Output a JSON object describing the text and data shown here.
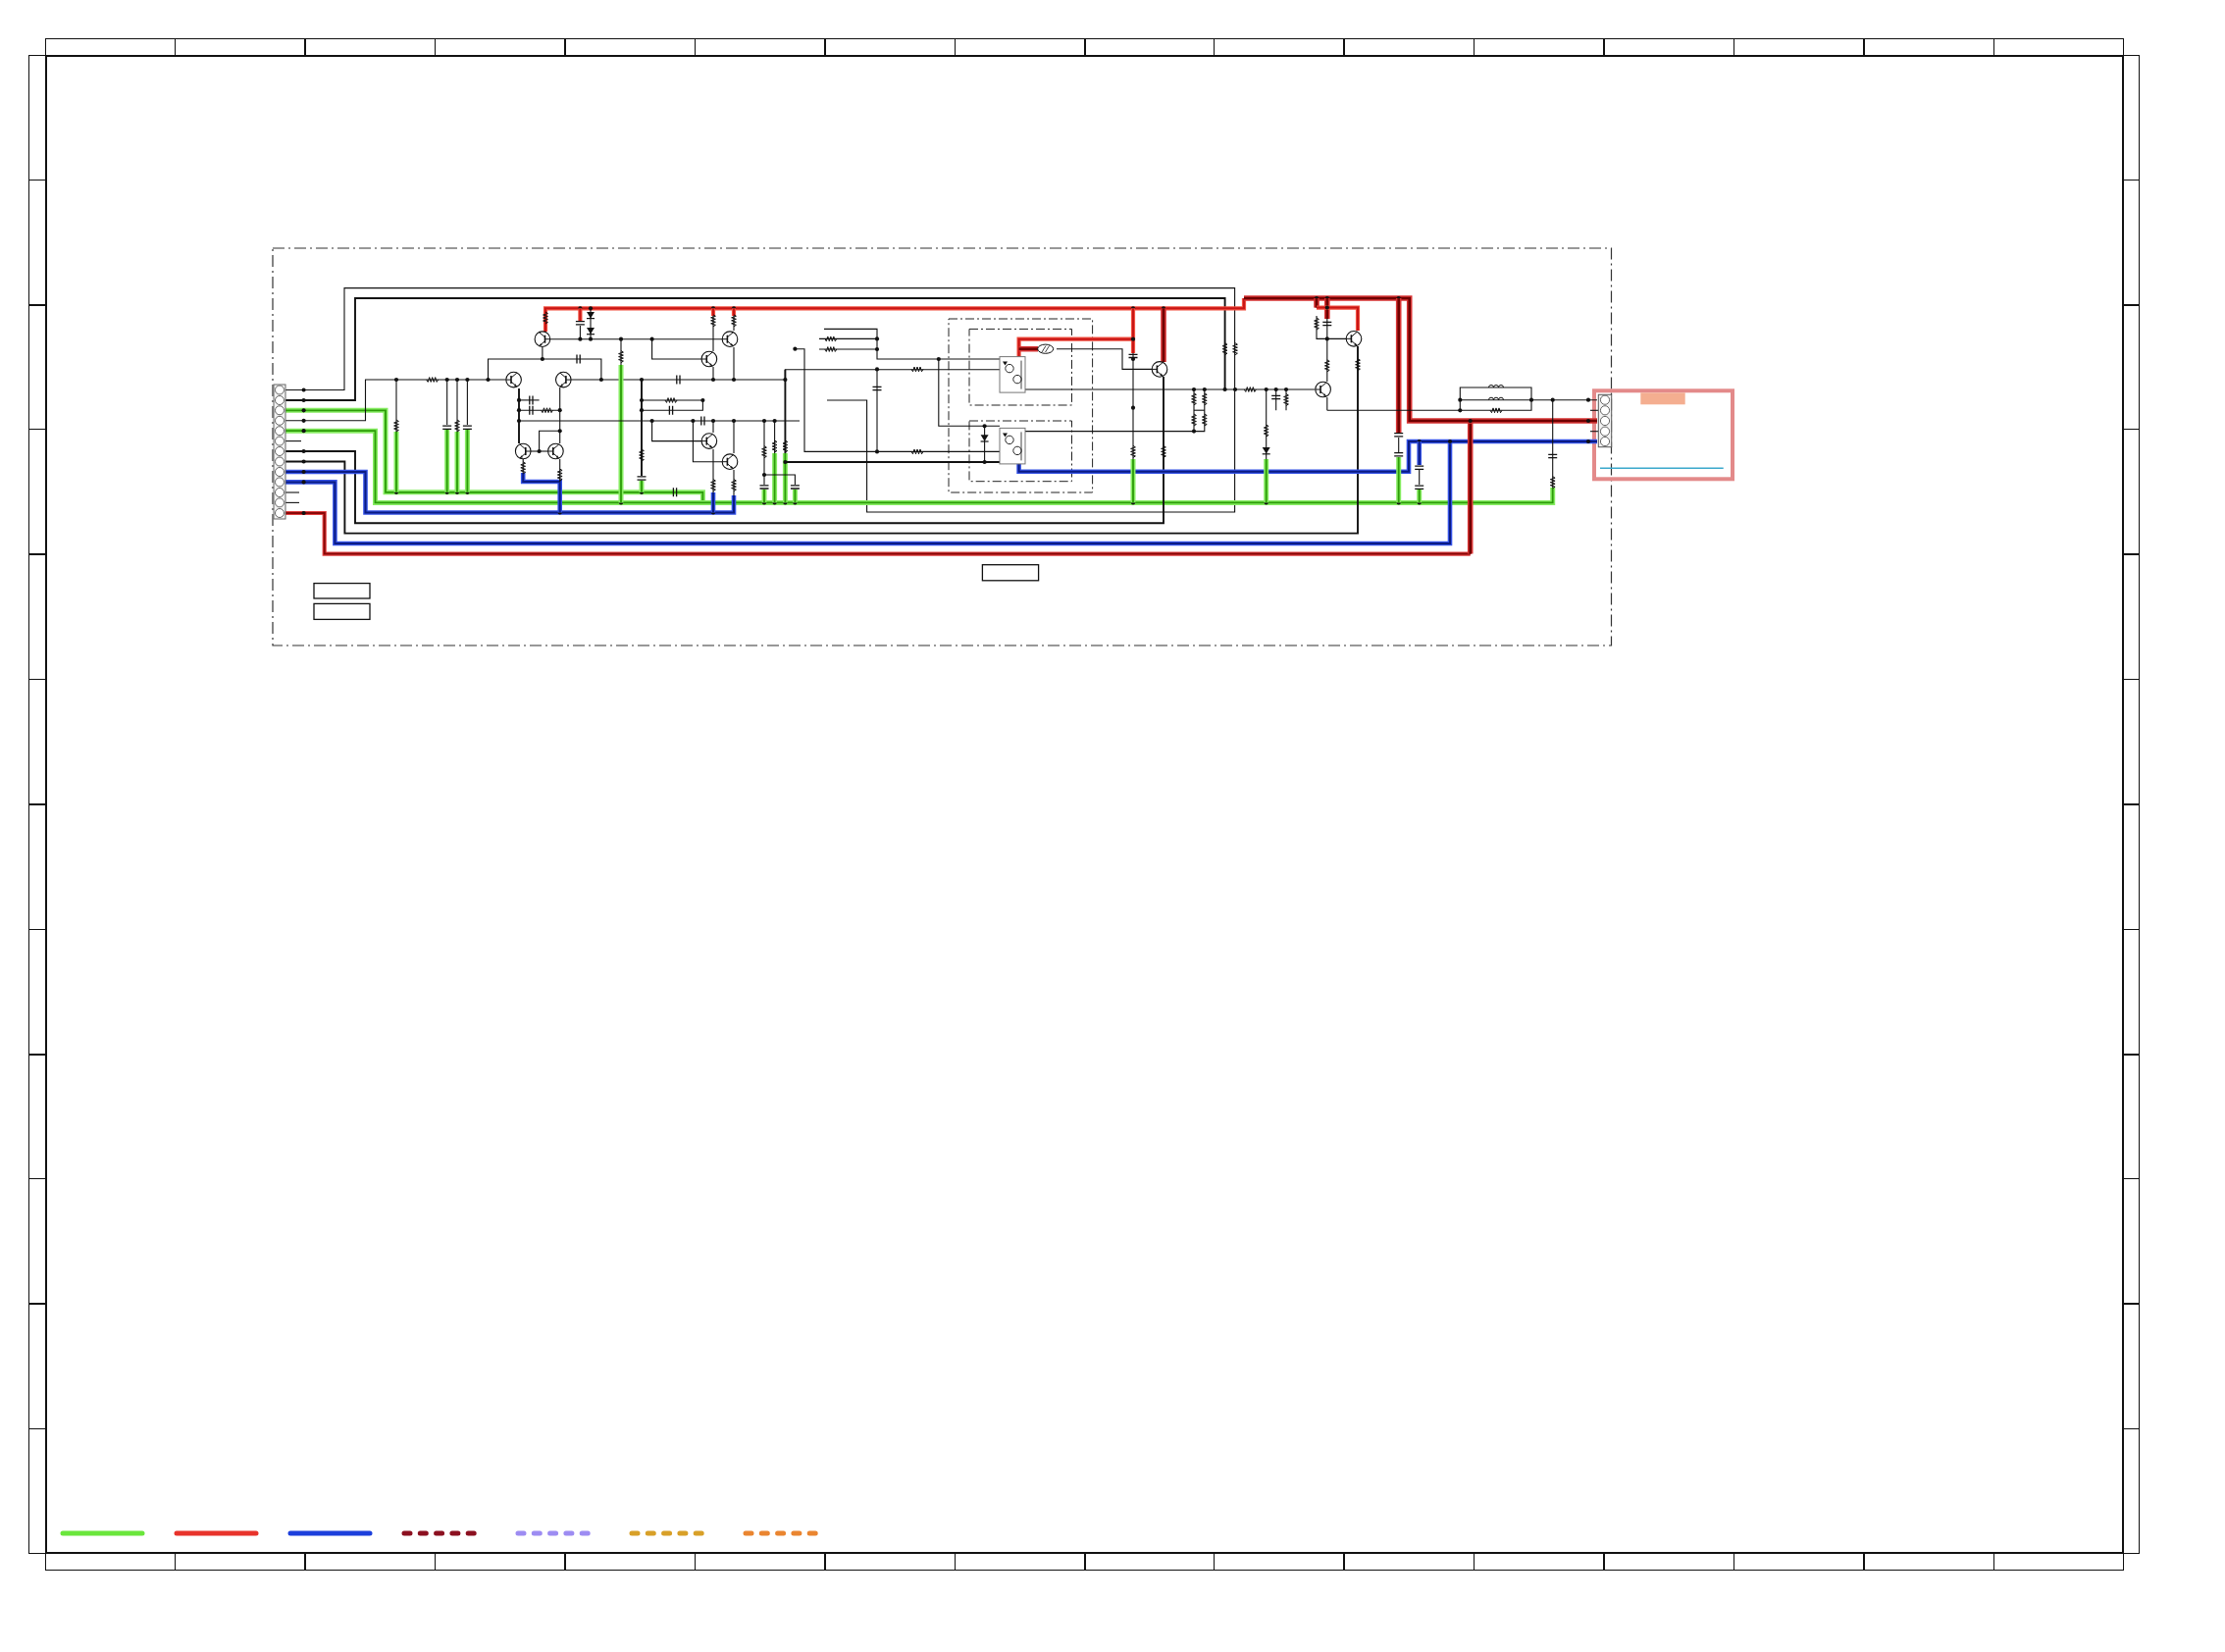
{
  "legend": [
    {
      "kind": "solid",
      "color": "#6ae63c"
    },
    {
      "kind": "solid",
      "color": "#e8332b"
    },
    {
      "kind": "solid",
      "color": "#1c3fdc"
    },
    {
      "kind": "dashed",
      "color": "#8c1020"
    },
    {
      "kind": "dashed",
      "color": "#9d8cf2"
    },
    {
      "kind": "dashed",
      "color": "#d8a028"
    },
    {
      "kind": "dashed",
      "color": "#ea8530"
    }
  ]
}
